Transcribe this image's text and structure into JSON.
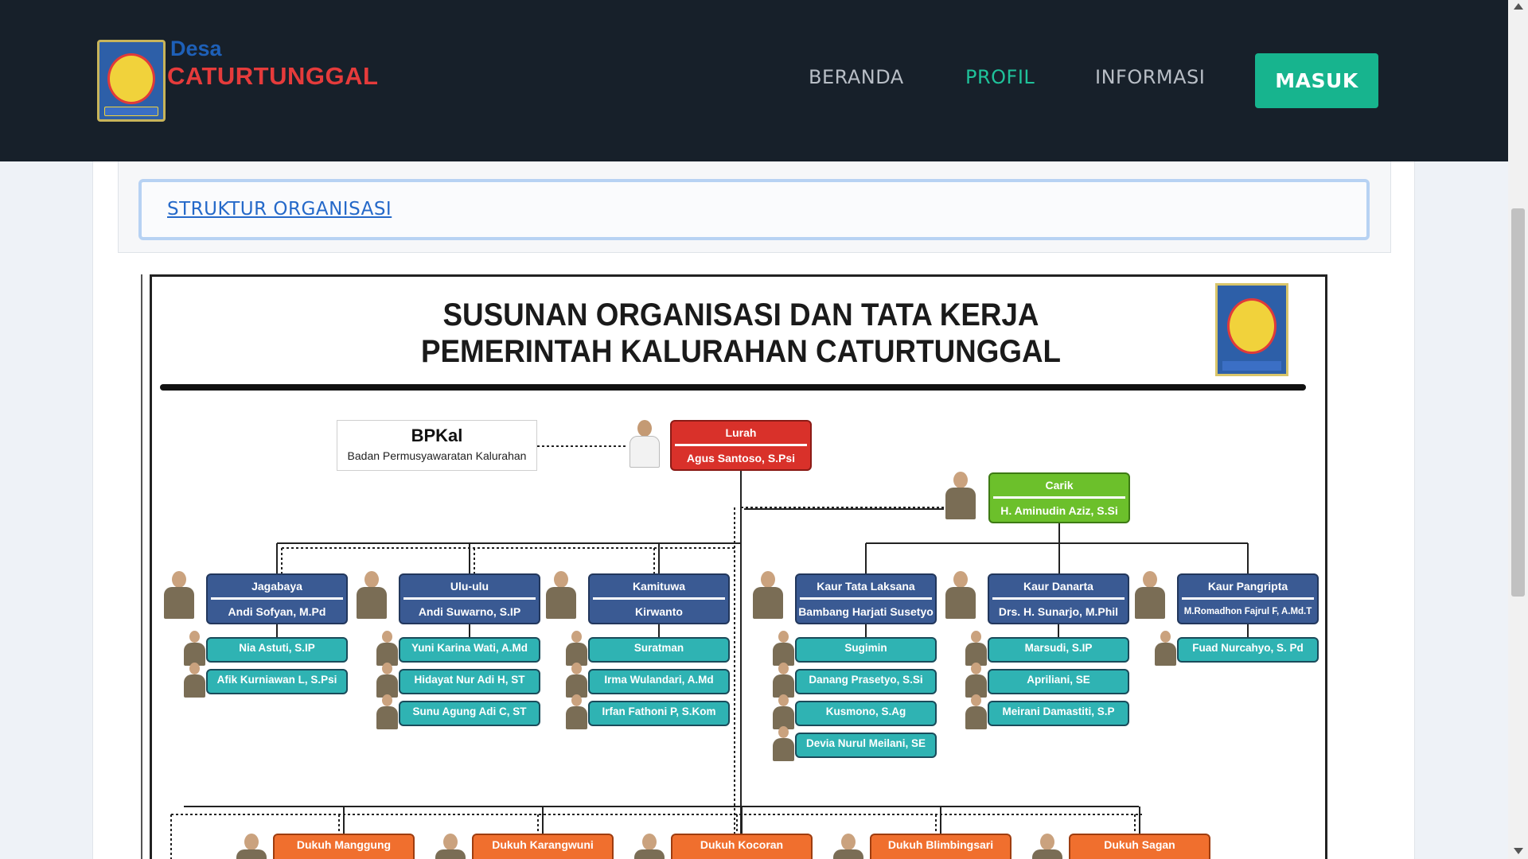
{
  "brand": {
    "prefix": "Desa",
    "name": "CATURTUNGGAL",
    "emblem_icon": "sleman-emblem-icon"
  },
  "nav": {
    "items": [
      {
        "label": "BERANDA",
        "active": false
      },
      {
        "label": "PROFIL",
        "active": true
      },
      {
        "label": "INFORMASI",
        "active": false
      }
    ],
    "login_label": "MASUK"
  },
  "section": {
    "link_label": "STRUKTUR ORGANISASI"
  },
  "org_chart": {
    "title_line1": "SUSUNAN ORGANISASI DAN TATA KERJA",
    "title_line2": "PEMERINTAH KALURAHAN CATURTUNGGAL",
    "bpkal": {
      "title": "BPKal",
      "subtitle": "Badan Permusyawaratan Kalurahan"
    },
    "lurah": {
      "role": "Lurah",
      "name": "Agus Santoso, S.Psi"
    },
    "carik": {
      "role": "Carik",
      "name": "H. Aminudin Aziz, S.Si"
    },
    "units": [
      {
        "role": "Jagabaya",
        "name": "Andi Sofyan, M.Pd",
        "staff": [
          "Nia Astuti, S.IP",
          "Afik Kurniawan L, S.Psi"
        ]
      },
      {
        "role": "Ulu-ulu",
        "name": "Andi Suwarno, S.IP",
        "staff": [
          "Yuni Karina Wati, A.Md",
          "Hidayat Nur Adi H, ST",
          "Sunu Agung Adi C, ST"
        ]
      },
      {
        "role": "Kamituwa",
        "name": "Kirwanto",
        "staff": [
          "Suratman",
          "Irma Wulandari, A.Md",
          "Irfan Fathoni P, S.Kom"
        ]
      },
      {
        "role": "Kaur Tata Laksana",
        "name": "Bambang Harjati Susetyo",
        "staff": [
          "Sugimin",
          "Danang Prasetyo, S.Si",
          "Kusmono, S.Ag",
          "Devia Nurul Meilani, SE"
        ]
      },
      {
        "role": "Kaur Danarta",
        "name": "Drs. H. Sunarjo, M.Phil",
        "staff": [
          "Marsudi, S.IP",
          "Apriliani, SE",
          "Meirani Damastiti, S.P"
        ]
      },
      {
        "role": "Kaur Pangripta",
        "name": "M.Romadhon Fajrul F, A.Md.T",
        "staff": [
          "Fuad Nurcahyo, S. Pd"
        ]
      }
    ],
    "dukuh": [
      "Dukuh Manggung",
      "Dukuh Karangwuni",
      "Dukuh Kocoran",
      "Dukuh Blimbingsari",
      "Dukuh Sagan"
    ]
  }
}
